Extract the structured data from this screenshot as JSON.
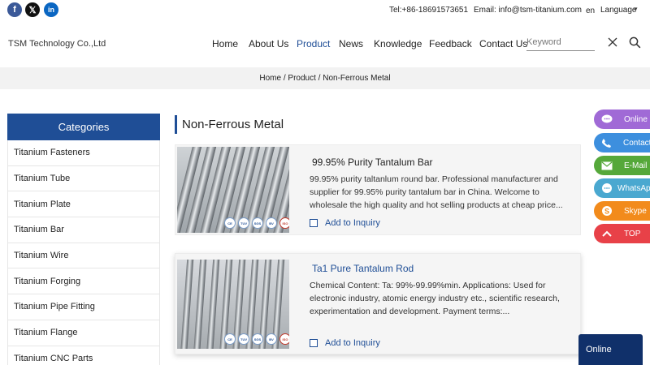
{
  "topbar": {
    "social": [
      {
        "name": "facebook",
        "glyph": "f"
      },
      {
        "name": "x",
        "glyph": "𝕏"
      },
      {
        "name": "linkedin",
        "glyph": "in"
      }
    ],
    "tel": "Tel:+86-18691573651",
    "email": "Email: info@tsm-titanium.com",
    "lang_code": "en",
    "lang_label": "Language"
  },
  "header": {
    "company": "TSM Technology Co.,Ltd",
    "nav": [
      "Home",
      "About Us",
      "Product",
      "News",
      "Knowledge",
      "Feedback",
      "Contact Us"
    ],
    "active_nav": "Product",
    "search_placeholder": "Keyword"
  },
  "breadcrumb": {
    "items": [
      "Home",
      "Product",
      "Non-Ferrous Metal"
    ],
    "separator": " / "
  },
  "sidebar": {
    "title": "Categories",
    "items": [
      "Titanium Fasteners",
      "Titanium Tube",
      "Titanium Plate",
      "Titanium Bar",
      "Titanium Wire",
      "Titanium Forging",
      "Titanium Pipe Fitting",
      "Titanium Flange",
      "Titanium CNC Parts"
    ]
  },
  "main": {
    "title": "Non-Ferrous Metal",
    "products": [
      {
        "title": "99.95% Purity Tantalum Bar",
        "description": "99.95% purity taltanlum round bar. Professional manufacturer and supplier for 99.95% purity tantalum bar in China. Welcome to wholesale the high quality and hot selling products at cheap price...",
        "inquiry_label": "Add to Inquiry",
        "certs": [
          "CE",
          "TUV",
          "SGS",
          "BV",
          "ISO"
        ]
      },
      {
        "title": "Ta1 Pure Tantalum Rod",
        "description": "Chemical Content: Ta: 99%-99.99%min. Applications: Used for electronic industry, atomic energy industry etc., scientific research, experimentation and development. Payment terms:...",
        "inquiry_label": "Add to Inquiry",
        "certs": [
          "CE",
          "TUV",
          "SGS",
          "BV",
          "ISO"
        ]
      }
    ]
  },
  "float_contact": [
    {
      "label": "Online",
      "icon": "chat-bubble-icon"
    },
    {
      "label": "Contact",
      "icon": "phone-icon"
    },
    {
      "label": "E-Mail",
      "icon": "mail-icon"
    },
    {
      "label": "WhatsApp",
      "icon": "whatsapp-icon"
    },
    {
      "label": "Skype",
      "icon": "skype-icon"
    },
    {
      "label": "TOP",
      "icon": "chevron-up-icon"
    }
  ],
  "online_tab": "Online",
  "colors": {
    "brand_blue": "#1f4e96",
    "online_purple": "#a06ad6",
    "contact_blue": "#3d8fde",
    "email_green": "#55a83a",
    "whatsapp_blue": "#4aa8d0",
    "skype_orange": "#f28b1c",
    "top_red": "#e84148"
  }
}
